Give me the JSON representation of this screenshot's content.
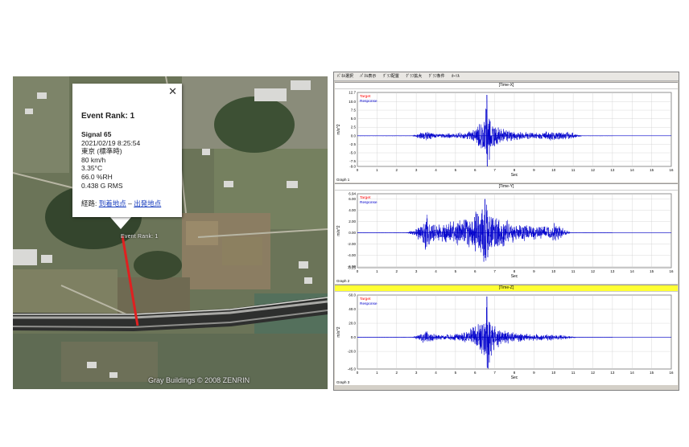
{
  "map": {
    "popup": {
      "title": "Event Rank: 1",
      "signal": "Signal 65",
      "datetime": "2021/02/19 8:25:54",
      "location": "東京 (標準時)",
      "speed": "80 km/h",
      "temperature": "3.35°C",
      "humidity": "66.0 %RH",
      "rms": "0.438 G RMS",
      "route_label": "経路:",
      "route_to": "到着地点",
      "route_sep": " – ",
      "route_from": "出発地点",
      "close_icon": "close-icon"
    },
    "marker_label": "Event Rank: 1",
    "credit": "Gray Buildings © 2008 ZENRIN",
    "route_color": "#e02020"
  },
  "plot_window": {
    "menu": [
      "ﾊﾟﾈﾙ選択",
      "ﾊﾟﾈﾙ表示",
      "ｸﾞﾗﾌ配置",
      "ｸﾞﾗﾌ拡大",
      "ｸﾞﾗﾌ条件",
      "ｶｰｿﾙ"
    ],
    "panels": [
      {
        "title": "[Time-X]",
        "graph": "Graph 1",
        "active": false
      },
      {
        "title": "[Time-Y]",
        "graph": "Graph 2",
        "active": false
      },
      {
        "title": "[Time-Z]",
        "graph": "Graph 3",
        "active": true
      }
    ]
  },
  "chart_data": [
    {
      "type": "line",
      "title": "[Time-X]",
      "xlabel": "Sec",
      "ylabel": "m/s^2",
      "xlim": [
        0,
        16
      ],
      "ylim": [
        -9.0,
        12.7
      ],
      "x_ticks": [
        0,
        1,
        2,
        3,
        4,
        5,
        6,
        7,
        8,
        9,
        10,
        11,
        12,
        13,
        14,
        15,
        16
      ],
      "y_ticks": [
        "12.7",
        "10.0",
        "7.5",
        "5.0",
        "2.5",
        "0.0",
        "-2.5",
        "-5.0",
        "-7.5",
        "-9.0"
      ],
      "legend": [
        "Target",
        "Response"
      ],
      "legend_colors": [
        "#ff0000",
        "#0000cc"
      ],
      "grid": true,
      "series": [
        {
          "name": "Response",
          "color": "#0000cc",
          "envelope": [
            [
              0,
              0.05
            ],
            [
              2.8,
              0.1
            ],
            [
              3.0,
              0.6
            ],
            [
              3.2,
              1.0
            ],
            [
              3.5,
              1.5
            ],
            [
              3.8,
              1.0
            ],
            [
              4.2,
              0.7
            ],
            [
              4.8,
              0.8
            ],
            [
              5.2,
              1.0
            ],
            [
              5.6,
              1.2
            ],
            [
              5.9,
              2.0
            ],
            [
              6.1,
              3.5
            ],
            [
              6.3,
              5.0
            ],
            [
              6.5,
              7.0
            ],
            [
              6.6,
              12.0
            ],
            [
              6.7,
              10.0
            ],
            [
              6.8,
              6.0
            ],
            [
              7.0,
              3.5
            ],
            [
              7.3,
              2.5
            ],
            [
              7.7,
              1.8
            ],
            [
              8.2,
              1.3
            ],
            [
              8.8,
              1.2
            ],
            [
              9.2,
              1.0
            ],
            [
              9.6,
              1.4
            ],
            [
              10.1,
              1.6
            ],
            [
              10.6,
              1.3
            ],
            [
              11.0,
              1.0
            ],
            [
              11.3,
              0.3
            ],
            [
              11.5,
              0.05
            ],
            [
              16,
              0.05
            ]
          ]
        }
      ]
    },
    {
      "type": "line",
      "title": "[Time-Y]",
      "xlabel": "Sec",
      "ylabel": "m/s^2",
      "xlim": [
        0,
        16
      ],
      "ylim": [
        -6.25,
        6.94
      ],
      "x_ticks": [
        0,
        1,
        2,
        3,
        4,
        5,
        6,
        7,
        8,
        9,
        10,
        11,
        12,
        13,
        14,
        15,
        16
      ],
      "y_ticks": [
        "6.94",
        "6.00",
        "4.00",
        "2.00",
        "0.00",
        "-2.00",
        "-4.00",
        "-6.00",
        "-6.25"
      ],
      "legend": [
        "Target",
        "Response"
      ],
      "legend_colors": [
        "#ff0000",
        "#0000cc"
      ],
      "grid": true,
      "series": [
        {
          "name": "Response",
          "color": "#0000cc",
          "envelope": [
            [
              0,
              0.03
            ],
            [
              2.5,
              0.05
            ],
            [
              2.7,
              0.3
            ],
            [
              3.0,
              1.0
            ],
            [
              3.3,
              2.0
            ],
            [
              3.5,
              4.0
            ],
            [
              3.7,
              2.5
            ],
            [
              4.0,
              1.5
            ],
            [
              4.5,
              2.0
            ],
            [
              5.0,
              2.5
            ],
            [
              5.5,
              3.0
            ],
            [
              5.9,
              3.5
            ],
            [
              6.2,
              4.5
            ],
            [
              6.5,
              6.0
            ],
            [
              6.7,
              5.0
            ],
            [
              7.0,
              3.5
            ],
            [
              7.4,
              3.0
            ],
            [
              7.8,
              2.2
            ],
            [
              8.3,
              1.7
            ],
            [
              8.8,
              1.5
            ],
            [
              9.3,
              1.4
            ],
            [
              9.8,
              1.2
            ],
            [
              10.1,
              2.0
            ],
            [
              10.3,
              1.3
            ],
            [
              10.6,
              0.6
            ],
            [
              10.9,
              0.05
            ],
            [
              16,
              0.03
            ]
          ]
        }
      ]
    },
    {
      "type": "line",
      "title": "[Time-Z]",
      "xlabel": "Sec",
      "ylabel": "m/s^2",
      "xlim": [
        0,
        16
      ],
      "ylim": [
        -45.0,
        60.0
      ],
      "x_ticks": [
        0,
        1,
        2,
        3,
        4,
        5,
        6,
        7,
        8,
        9,
        10,
        11,
        12,
        13,
        14,
        15,
        16
      ],
      "y_ticks": [
        "60.0",
        "40.0",
        "20.0",
        "0.0",
        "-20.0",
        "-45.0"
      ],
      "legend": [
        "Target",
        "Response"
      ],
      "legend_colors": [
        "#ff0000",
        "#0000cc"
      ],
      "grid": true,
      "series": [
        {
          "name": "Response",
          "color": "#0000cc",
          "envelope": [
            [
              0,
              0.2
            ],
            [
              2.8,
              0.5
            ],
            [
              3.0,
              3.0
            ],
            [
              3.3,
              8.0
            ],
            [
              3.5,
              10.0
            ],
            [
              3.8,
              6.0
            ],
            [
              4.2,
              4.0
            ],
            [
              4.7,
              5.0
            ],
            [
              5.2,
              6.0
            ],
            [
              5.6,
              10.0
            ],
            [
              5.9,
              16.0
            ],
            [
              6.1,
              20.0
            ],
            [
              6.3,
              28.0
            ],
            [
              6.5,
              40.0
            ],
            [
              6.6,
              58.0
            ],
            [
              6.7,
              44.0
            ],
            [
              6.9,
              24.0
            ],
            [
              7.1,
              16.0
            ],
            [
              7.5,
              11.0
            ],
            [
              7.9,
              8.0
            ],
            [
              8.4,
              6.0
            ],
            [
              9.0,
              5.0
            ],
            [
              9.5,
              4.5
            ],
            [
              10.0,
              5.0
            ],
            [
              10.5,
              4.0
            ],
            [
              10.9,
              2.0
            ],
            [
              11.2,
              0.5
            ],
            [
              11.5,
              0.2
            ],
            [
              16,
              0.2
            ]
          ]
        }
      ]
    }
  ]
}
